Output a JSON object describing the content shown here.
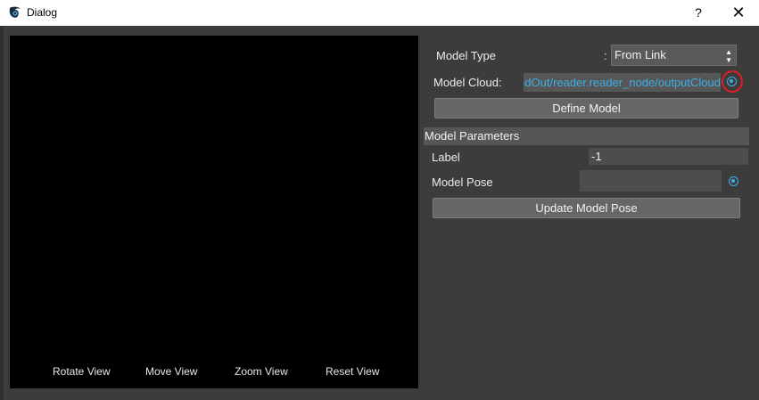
{
  "window": {
    "title": "Dialog",
    "help_label": "?",
    "close_label": "✕"
  },
  "viewer": {
    "rotate_label": "Rotate View",
    "move_label": "Move View",
    "zoom_label": "Zoom View",
    "reset_label": "Reset View"
  },
  "panel": {
    "model_type_label": "Model Type",
    "model_type_sep": ":",
    "model_type_value": "From Link",
    "model_cloud_label": "Model Cloud:",
    "model_cloud_value": "ReadCloudOut/reader.reader_node/outputCloud",
    "define_label": "Define Model",
    "params_header": "Model Parameters",
    "label_label": "Label",
    "label_value": "-1",
    "pose_label": "Model Pose",
    "pose_value": "",
    "update_label": "Update Model Pose"
  },
  "colors": {
    "accent": "#3daee9",
    "highlight": "#e01b24",
    "background": "#3c3c3c"
  }
}
